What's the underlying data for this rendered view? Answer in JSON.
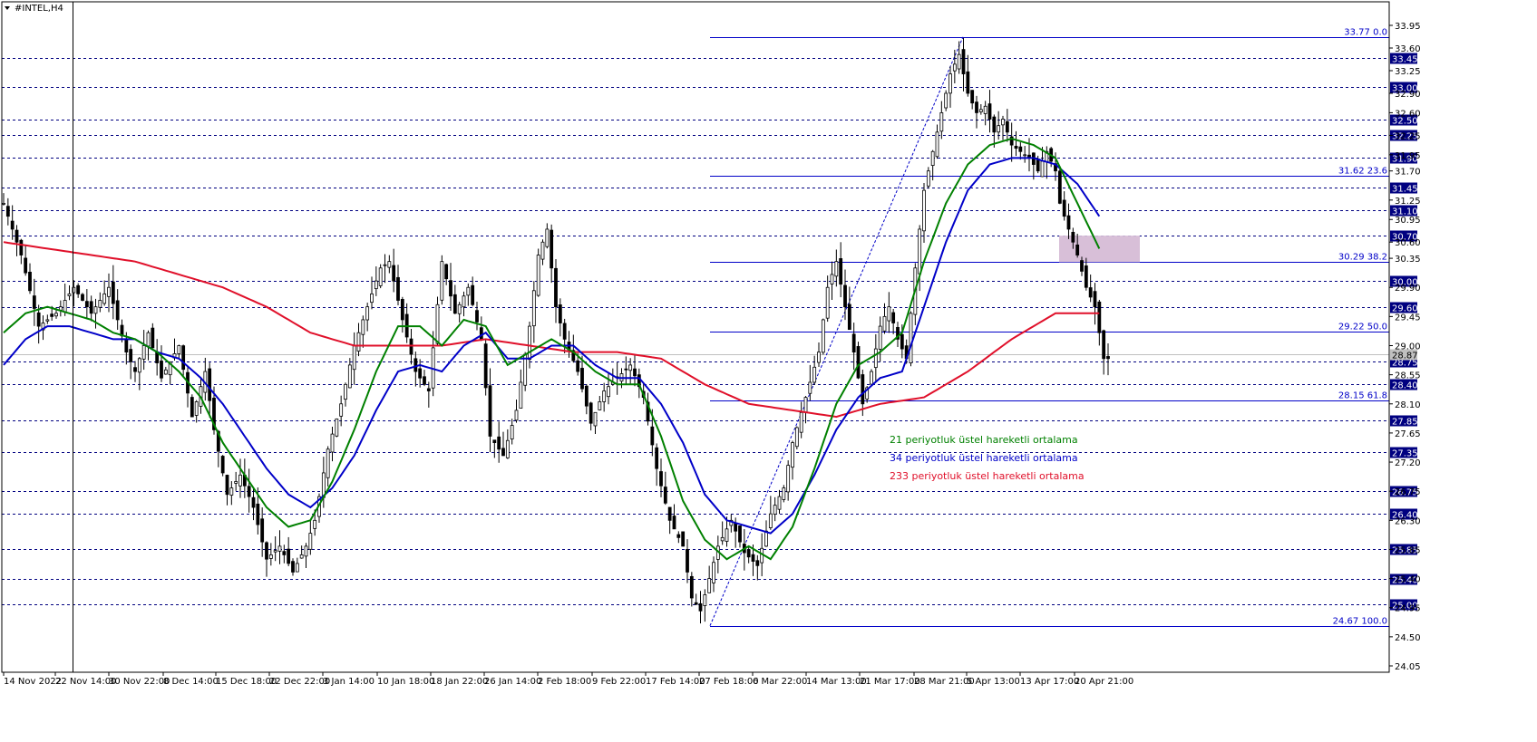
{
  "window": {
    "title": "#INTEL,H4"
  },
  "chart_data": {
    "type": "candlestick",
    "symbol": "#INTEL",
    "timeframe": "H4",
    "ylim": [
      24.05,
      33.95
    ],
    "price_axis_ticks": [
      33.95,
      33.6,
      33.25,
      32.9,
      32.6,
      32.25,
      31.95,
      31.7,
      31.25,
      30.95,
      30.6,
      30.35,
      29.9,
      29.45,
      29.0,
      28.55,
      28.1,
      27.65,
      27.2,
      26.75,
      26.3,
      25.85,
      25.4,
      24.95,
      24.5,
      24.05
    ],
    "price_axis_ticks_labels": [
      "33.95",
      "33.60",
      "33.25",
      "32.90",
      "32.60",
      "32.25",
      "31.95",
      "31.70",
      "31.25",
      "30.95",
      "30.60",
      "30.35",
      "29.90",
      "29.45",
      "29.00",
      "28.55",
      "28.10",
      "27.65",
      "27.20",
      "26.75",
      "26.30",
      "25.85",
      "25.40",
      "24.95",
      "24.50",
      "24.05"
    ],
    "time_labels": [
      "14 Nov 2022",
      "22 Nov 14:00",
      "30 Nov 22:00",
      "8 Dec 14:00",
      "15 Dec 18:00",
      "22 Dec 22:00",
      "3 Jan 14:00",
      "10 Jan 18:00",
      "18 Jan 22:00",
      "26 Jan 14:00",
      "2 Feb 18:00",
      "9 Feb 22:00",
      "17 Feb 14:00",
      "27 Feb 18:00",
      "6 Mar 22:00",
      "14 Mar 13:00",
      "21 Mar 17:00",
      "28 Mar 21:00",
      "5 Apr 13:00",
      "13 Apr 17:00",
      "20 Apr 21:00"
    ],
    "horizontal_levels": [
      33.45,
      33.0,
      32.5,
      32.25,
      31.9,
      31.45,
      31.1,
      30.7,
      30.0,
      29.6,
      28.75,
      28.4,
      27.85,
      27.35,
      26.75,
      26.4,
      25.85,
      25.4,
      25.0
    ],
    "horizontal_levels_labels": [
      "33.45",
      "33.00",
      "32.50",
      "32.25",
      "31.90",
      "31.45",
      "31.10",
      "30.70",
      "30.00",
      "29.60",
      "28.75",
      "28.40",
      "27.85",
      "27.35",
      "26.75",
      "26.40",
      "25.85",
      "25.40",
      "25.00"
    ],
    "current_price": 28.87,
    "current_price_label": "28.87",
    "fibonacci": {
      "levels": [
        {
          "price": 33.77,
          "label": "33.77 0.0"
        },
        {
          "price": 31.62,
          "label": "31.62 23.6"
        },
        {
          "price": 30.29,
          "label": "30.29 38.2"
        },
        {
          "price": 29.22,
          "label": "29.22 50.0"
        },
        {
          "price": 28.15,
          "label": "28.15 61.8"
        },
        {
          "price": 24.67,
          "label": "24.67 100.0"
        }
      ]
    },
    "zone": {
      "from": 30.29,
      "to": 30.7,
      "color": "#d8bfd8"
    },
    "legend": [
      {
        "label": "21 periyotluk üstel hareketli ortalama",
        "color": "#008000"
      },
      {
        "label": "34 periyotluk üstel hareketli ortalama",
        "color": "#0000c8"
      },
      {
        "label": "233 periyotluk üstel hareketli ortalama",
        "color": "#e0102a"
      }
    ],
    "price_path": [
      [
        0,
        31.2
      ],
      [
        4,
        30.4
      ],
      [
        8,
        29.3
      ],
      [
        12,
        29.5
      ],
      [
        16,
        29.9
      ],
      [
        20,
        29.5
      ],
      [
        24,
        29.9
      ],
      [
        28,
        28.9
      ],
      [
        30,
        28.6
      ],
      [
        33,
        29.2
      ],
      [
        36,
        28.5
      ],
      [
        40,
        29.0
      ],
      [
        43,
        27.9
      ],
      [
        46,
        28.6
      ],
      [
        48,
        27.7
      ],
      [
        51,
        26.7
      ],
      [
        54,
        27.0
      ],
      [
        57,
        26.5
      ],
      [
        60,
        25.7
      ],
      [
        63,
        25.9
      ],
      [
        66,
        25.5
      ],
      [
        69,
        25.9
      ],
      [
        71,
        26.3
      ],
      [
        74,
        27.4
      ],
      [
        77,
        28.1
      ],
      [
        80,
        29.0
      ],
      [
        83,
        29.6
      ],
      [
        86,
        30.2
      ],
      [
        88,
        30.3
      ],
      [
        91,
        29.4
      ],
      [
        94,
        28.6
      ],
      [
        97,
        28.3
      ],
      [
        100,
        30.3
      ],
      [
        103,
        29.5
      ],
      [
        106,
        29.9
      ],
      [
        109,
        29.1
      ],
      [
        111,
        27.6
      ],
      [
        114,
        27.3
      ],
      [
        117,
        28.0
      ],
      [
        120,
        29.3
      ],
      [
        122,
        30.4
      ],
      [
        124,
        30.8
      ],
      [
        126,
        29.6
      ],
      [
        128,
        29.1
      ],
      [
        131,
        28.6
      ],
      [
        134,
        27.8
      ],
      [
        137,
        28.3
      ],
      [
        140,
        28.5
      ],
      [
        143,
        28.7
      ],
      [
        146,
        28.2
      ],
      [
        149,
        27.1
      ],
      [
        152,
        26.3
      ],
      [
        155,
        25.9
      ],
      [
        157,
        25.1
      ],
      [
        159,
        24.9
      ],
      [
        161,
        25.4
      ],
      [
        163,
        25.9
      ],
      [
        166,
        26.3
      ],
      [
        169,
        25.8
      ],
      [
        172,
        25.6
      ],
      [
        175,
        26.4
      ],
      [
        178,
        26.8
      ],
      [
        180,
        27.5
      ],
      [
        183,
        28.2
      ],
      [
        186,
        28.9
      ],
      [
        188,
        29.9
      ],
      [
        190,
        30.3
      ],
      [
        192,
        29.6
      ],
      [
        194,
        28.9
      ],
      [
        196,
        28.1
      ],
      [
        198,
        28.6
      ],
      [
        200,
        29.3
      ],
      [
        202,
        29.6
      ],
      [
        204,
        29.1
      ],
      [
        206,
        28.8
      ],
      [
        208,
        30.2
      ],
      [
        210,
        31.4
      ],
      [
        212,
        32.0
      ],
      [
        214,
        32.6
      ],
      [
        216,
        33.2
      ],
      [
        218,
        33.5
      ],
      [
        220,
        32.9
      ],
      [
        222,
        32.6
      ],
      [
        224,
        32.7
      ],
      [
        226,
        32.3
      ],
      [
        228,
        32.5
      ],
      [
        230,
        32.1
      ],
      [
        232,
        32.0
      ],
      [
        234,
        31.9
      ],
      [
        236,
        31.7
      ],
      [
        238,
        32.0
      ],
      [
        240,
        31.7
      ],
      [
        241,
        31.2
      ],
      [
        243,
        30.8
      ],
      [
        245,
        30.4
      ],
      [
        247,
        29.9
      ],
      [
        249,
        29.6
      ],
      [
        251,
        28.8
      ]
    ],
    "ema21_path": [
      [
        0,
        29.2
      ],
      [
        5,
        29.5
      ],
      [
        10,
        29.6
      ],
      [
        15,
        29.5
      ],
      [
        20,
        29.4
      ],
      [
        25,
        29.2
      ],
      [
        30,
        29.1
      ],
      [
        35,
        28.9
      ],
      [
        40,
        28.6
      ],
      [
        45,
        28.2
      ],
      [
        50,
        27.5
      ],
      [
        55,
        27.0
      ],
      [
        60,
        26.5
      ],
      [
        65,
        26.2
      ],
      [
        70,
        26.3
      ],
      [
        75,
        26.9
      ],
      [
        80,
        27.7
      ],
      [
        85,
        28.6
      ],
      [
        90,
        29.3
      ],
      [
        95,
        29.3
      ],
      [
        100,
        29.0
      ],
      [
        105,
        29.4
      ],
      [
        110,
        29.3
      ],
      [
        115,
        28.7
      ],
      [
        120,
        28.9
      ],
      [
        125,
        29.1
      ],
      [
        130,
        28.9
      ],
      [
        135,
        28.6
      ],
      [
        140,
        28.4
      ],
      [
        145,
        28.4
      ],
      [
        150,
        27.6
      ],
      [
        155,
        26.6
      ],
      [
        160,
        26.0
      ],
      [
        165,
        25.7
      ],
      [
        170,
        25.9
      ],
      [
        175,
        25.7
      ],
      [
        180,
        26.2
      ],
      [
        185,
        27.1
      ],
      [
        190,
        28.1
      ],
      [
        195,
        28.7
      ],
      [
        200,
        28.9
      ],
      [
        205,
        29.2
      ],
      [
        210,
        30.3
      ],
      [
        215,
        31.2
      ],
      [
        220,
        31.8
      ],
      [
        225,
        32.1
      ],
      [
        230,
        32.2
      ],
      [
        235,
        32.1
      ],
      [
        240,
        31.9
      ],
      [
        245,
        31.2
      ],
      [
        250,
        30.5
      ]
    ],
    "ema34_path": [
      [
        0,
        28.7
      ],
      [
        5,
        29.1
      ],
      [
        10,
        29.3
      ],
      [
        15,
        29.3
      ],
      [
        20,
        29.2
      ],
      [
        25,
        29.1
      ],
      [
        30,
        29.1
      ],
      [
        35,
        28.9
      ],
      [
        40,
        28.8
      ],
      [
        45,
        28.5
      ],
      [
        50,
        28.1
      ],
      [
        55,
        27.6
      ],
      [
        60,
        27.1
      ],
      [
        65,
        26.7
      ],
      [
        70,
        26.5
      ],
      [
        75,
        26.8
      ],
      [
        80,
        27.3
      ],
      [
        85,
        28.0
      ],
      [
        90,
        28.6
      ],
      [
        95,
        28.7
      ],
      [
        100,
        28.6
      ],
      [
        105,
        29.0
      ],
      [
        110,
        29.2
      ],
      [
        115,
        28.8
      ],
      [
        120,
        28.8
      ],
      [
        125,
        29.0
      ],
      [
        130,
        29.0
      ],
      [
        135,
        28.7
      ],
      [
        140,
        28.5
      ],
      [
        145,
        28.5
      ],
      [
        150,
        28.1
      ],
      [
        155,
        27.5
      ],
      [
        160,
        26.7
      ],
      [
        165,
        26.3
      ],
      [
        170,
        26.2
      ],
      [
        175,
        26.1
      ],
      [
        180,
        26.4
      ],
      [
        185,
        27.0
      ],
      [
        190,
        27.7
      ],
      [
        195,
        28.2
      ],
      [
        200,
        28.5
      ],
      [
        205,
        28.6
      ],
      [
        210,
        29.6
      ],
      [
        215,
        30.6
      ],
      [
        220,
        31.4
      ],
      [
        225,
        31.8
      ],
      [
        230,
        31.9
      ],
      [
        235,
        31.9
      ],
      [
        240,
        31.8
      ],
      [
        245,
        31.5
      ],
      [
        250,
        31.0
      ]
    ],
    "ema233_path": [
      [
        0,
        30.6
      ],
      [
        10,
        30.5
      ],
      [
        20,
        30.4
      ],
      [
        30,
        30.3
      ],
      [
        40,
        30.1
      ],
      [
        50,
        29.9
      ],
      [
        60,
        29.6
      ],
      [
        70,
        29.2
      ],
      [
        80,
        29.0
      ],
      [
        90,
        29.0
      ],
      [
        100,
        29.0
      ],
      [
        110,
        29.1
      ],
      [
        120,
        29.0
      ],
      [
        130,
        28.9
      ],
      [
        140,
        28.9
      ],
      [
        150,
        28.8
      ],
      [
        160,
        28.4
      ],
      [
        170,
        28.1
      ],
      [
        180,
        28.0
      ],
      [
        190,
        27.9
      ],
      [
        200,
        28.1
      ],
      [
        210,
        28.2
      ],
      [
        220,
        28.6
      ],
      [
        230,
        29.1
      ],
      [
        240,
        29.5
      ],
      [
        250,
        29.5
      ]
    ]
  }
}
